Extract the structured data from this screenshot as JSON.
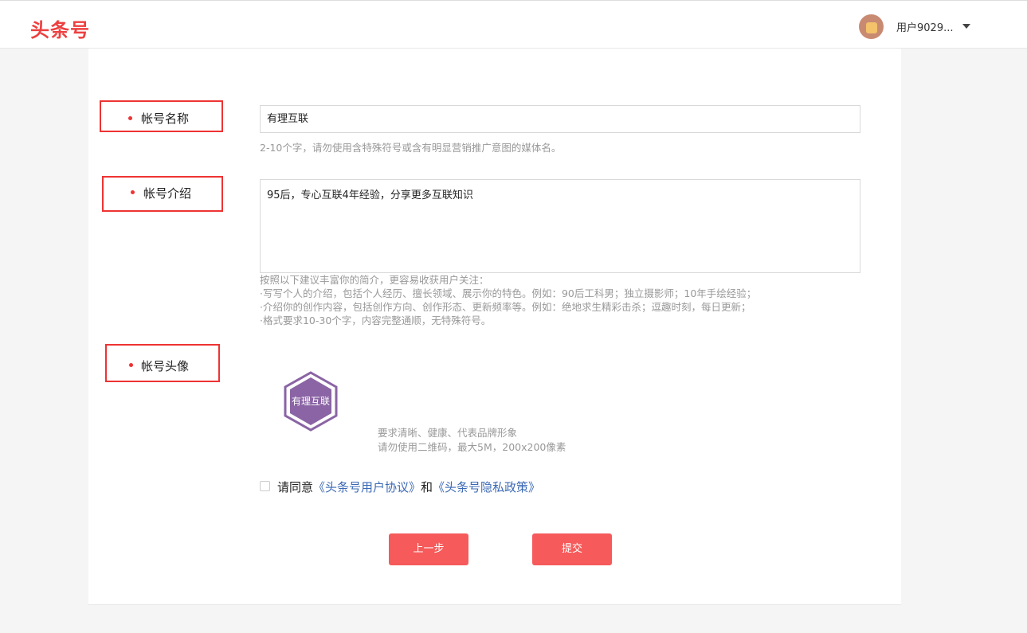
{
  "header": {
    "logo": "头条号",
    "username": "用户9029..."
  },
  "form": {
    "name_label": "帐号名称",
    "name_value": "有理互联",
    "name_hint": "2-10个字，请勿使用含特殊符号或含有明显营销推广意图的媒体名。",
    "intro_label": "帐号介绍",
    "intro_value": "95后，专心互联4年经验，分享更多互联知识",
    "intro_hints": [
      "按照以下建议丰富你的简介，更容易收获用户关注：",
      "·写写个人的介绍，包括个人经历、擅长领域、展示你的特色。例如：90后工科男；独立摄影师；10年手绘经验；",
      "·介绍你的创作内容，包括创作方向、创作形态、更新频率等。例如：绝地求生精彩击杀；逗趣时刻，每日更新；",
      "·格式要求10-30个字，内容完整通顺，无特殊符号。"
    ],
    "avatar_label": "帐号头像",
    "avatar_logo_text": "有理互联",
    "avatar_hints": [
      "要求清晰、健康、代表品牌形象",
      "请勿使用二维码，最大5M，200x200像素"
    ],
    "agree_prefix": "请同意",
    "agree_link1": "《头条号用户协议》",
    "agree_and": "和",
    "agree_link2": "《头条号隐私政策》",
    "prev_button": "上一步",
    "submit_button": "提交"
  }
}
